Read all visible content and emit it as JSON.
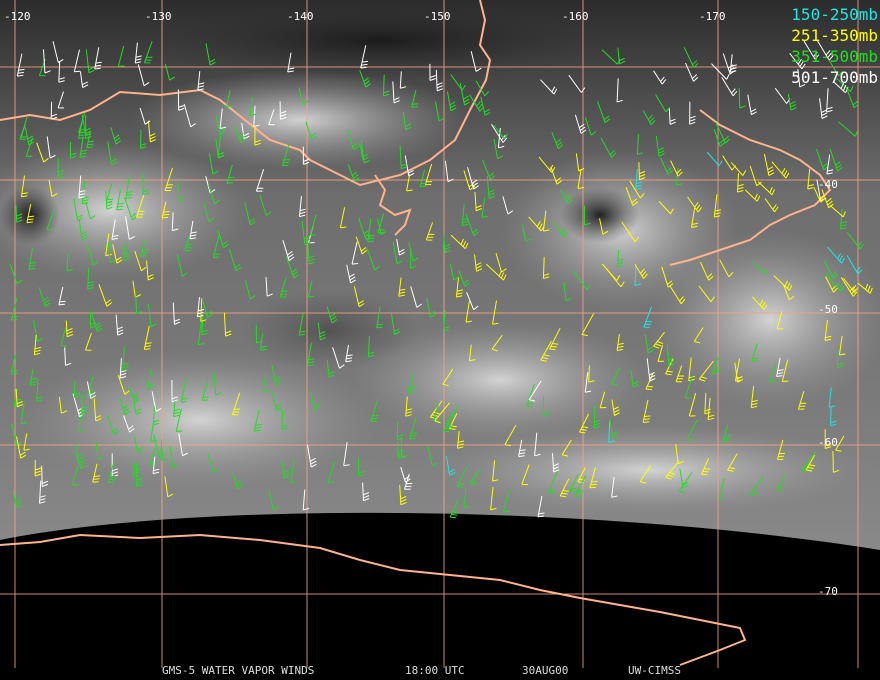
{
  "map": {
    "longitude_labels": [
      "-120",
      "-130",
      "-140",
      "-150",
      "-160",
      "-170"
    ],
    "latitude_labels": [
      "-40",
      "-50",
      "-60",
      "-70"
    ],
    "grid_color": "#f4a582",
    "coast_color": "#ffb38a"
  },
  "legend": {
    "items": [
      {
        "label": "150-250mb",
        "color": "#22e5e5"
      },
      {
        "label": "251-350mb",
        "color": "#ffff00"
      },
      {
        "label": "351-500mb",
        "color": "#22dd22"
      },
      {
        "label": "501-700mb",
        "color": "#ffffff"
      }
    ]
  },
  "footer": {
    "satellite_product": "GMS-5 WATER VAPOR WINDS",
    "time": "18:00 UTC",
    "date": "30AUG00",
    "source": "UW-CIMSS"
  }
}
